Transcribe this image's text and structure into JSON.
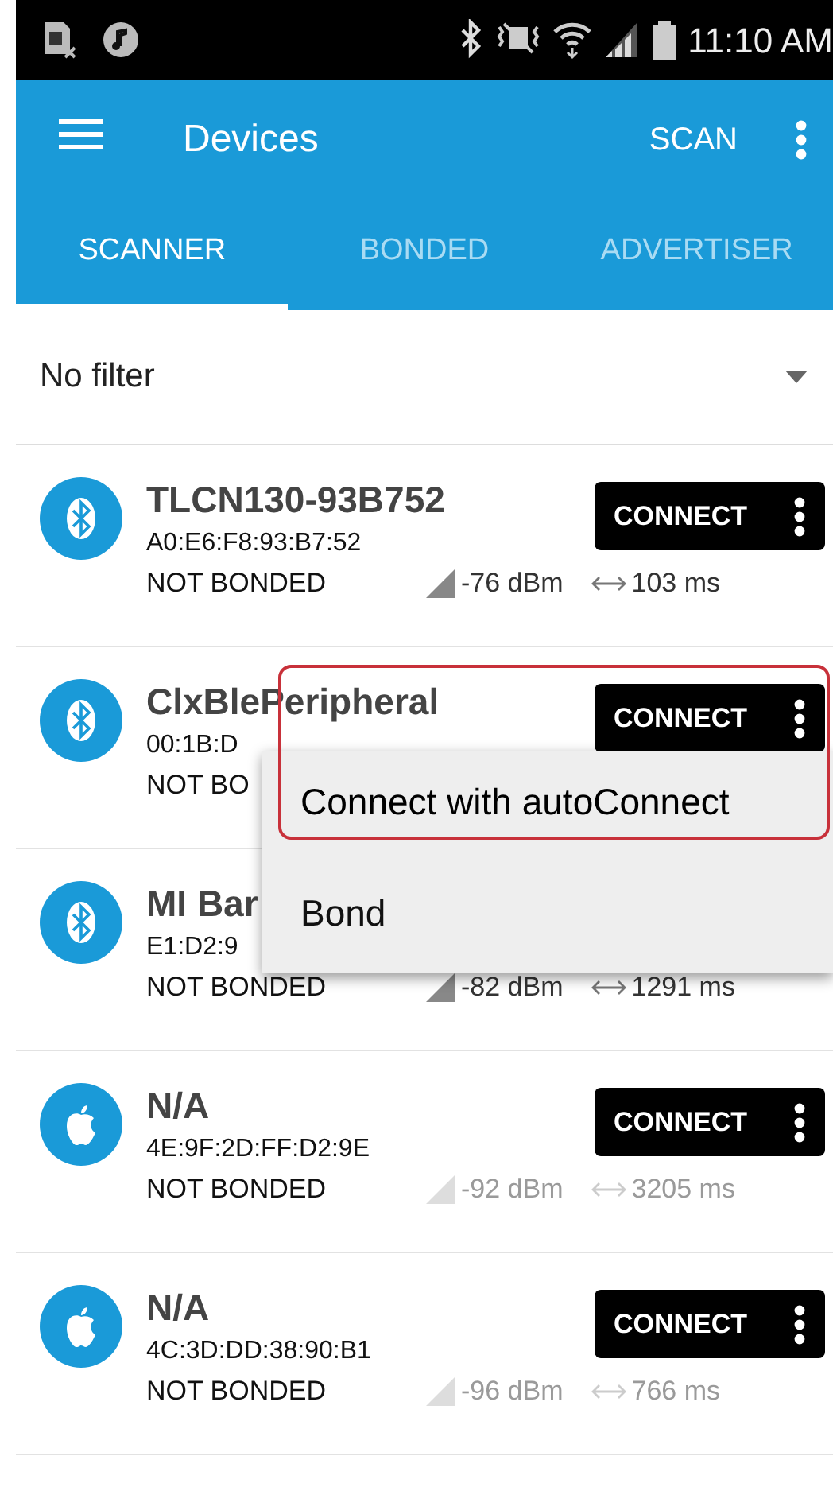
{
  "status_bar": {
    "time": "11:10 AM"
  },
  "app_bar": {
    "title": "Devices",
    "action": "SCAN"
  },
  "tabs": [
    {
      "label": "SCANNER",
      "selected": true
    },
    {
      "label": "BONDED",
      "selected": false
    },
    {
      "label": "ADVERTISER",
      "selected": false
    }
  ],
  "filter": {
    "value": "No filter"
  },
  "devices": [
    {
      "kind": "bluetooth",
      "name": "TLCN130-93B752",
      "address": "A0:E6:F8:93:B7:52",
      "bond_state": "NOT BONDED",
      "rssi": "-76 dBm",
      "interval": "103 ms",
      "stale": false,
      "button": "CONNECT"
    },
    {
      "kind": "bluetooth",
      "name": "ClxBlePeripheral",
      "address": "00:1B:D",
      "bond_state": "NOT BO",
      "button": "CONNECT"
    },
    {
      "kind": "bluetooth",
      "name": "MI Bar",
      "address": "E1:D2:9",
      "bond_state": "NOT BONDED",
      "rssi": "-82 dBm",
      "interval": "1291 ms",
      "stale": false
    },
    {
      "kind": "apple",
      "name": "N/A",
      "address": "4E:9F:2D:FF:D2:9E",
      "bond_state": "NOT BONDED",
      "rssi": "-92 dBm",
      "interval": "3205 ms",
      "stale": true,
      "button": "CONNECT"
    },
    {
      "kind": "apple",
      "name": "N/A",
      "address": "4C:3D:DD:38:90:B1",
      "bond_state": "NOT BONDED",
      "rssi": "-96 dBm",
      "interval": "766 ms",
      "stale": true,
      "button": "CONNECT"
    }
  ],
  "popup_menu": {
    "items": [
      {
        "label": "Connect with autoConnect",
        "highlighted": true
      },
      {
        "label": "Bond",
        "highlighted": false
      }
    ]
  }
}
